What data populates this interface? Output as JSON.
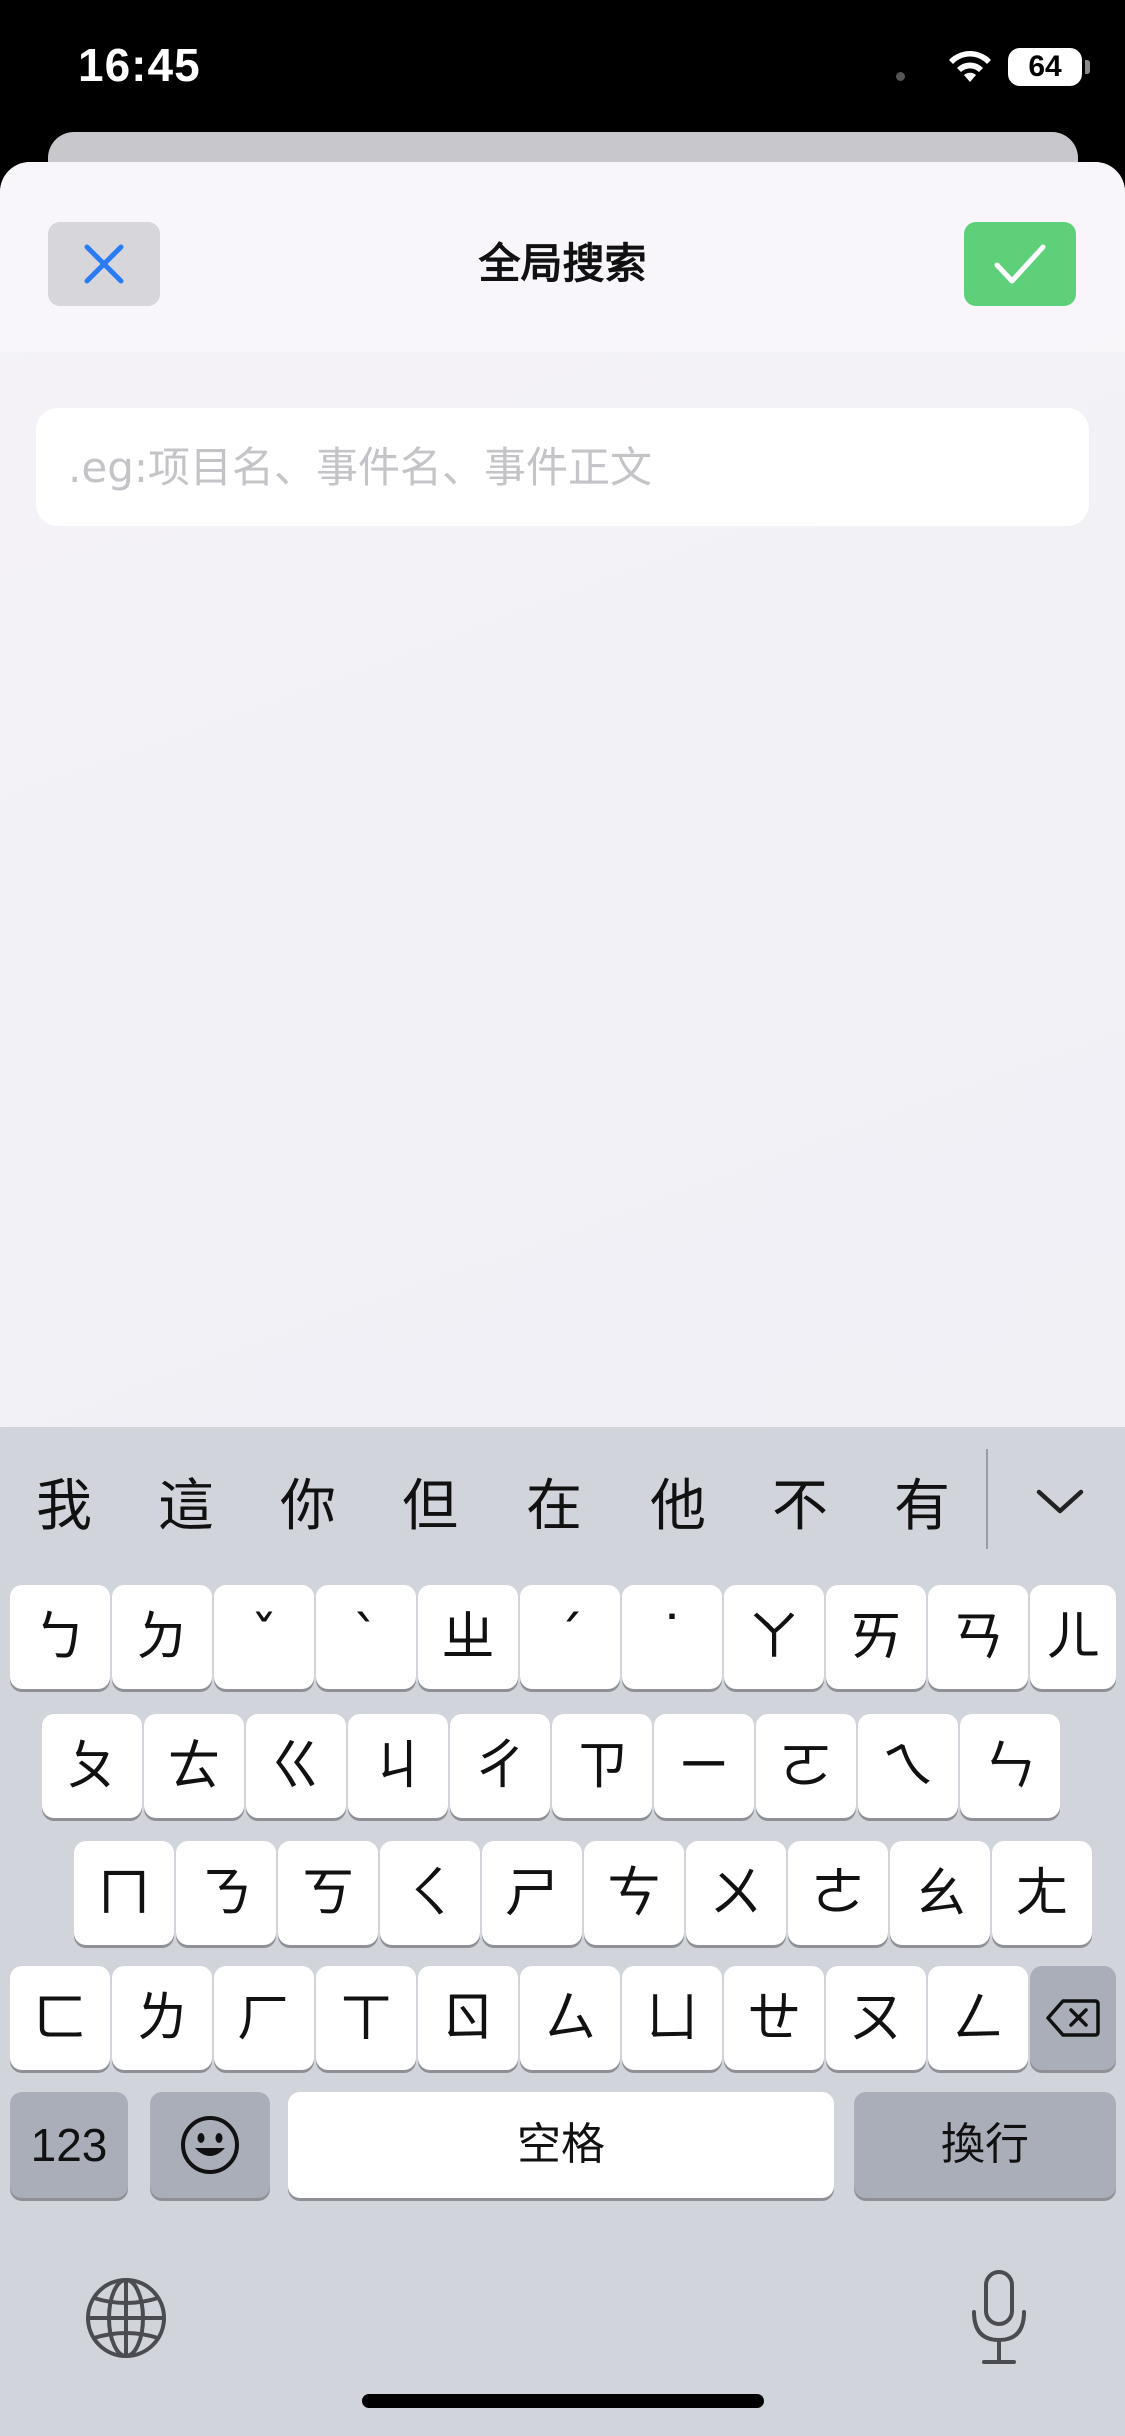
{
  "status_bar": {
    "time": "16:45",
    "battery": "64"
  },
  "sheet": {
    "title": "全局搜索",
    "close_icon": "close-x-icon",
    "confirm_icon": "checkmark-icon",
    "search": {
      "value": "",
      "placeholder": ".eg:项目名、事件名、事件正文"
    }
  },
  "keyboard": {
    "candidates": [
      "我",
      "這",
      "你",
      "但",
      "在",
      "他",
      "不",
      "有"
    ],
    "rows": [
      [
        "ㄅ",
        "ㄉ",
        "ˇ",
        "ˋ",
        "ㄓ",
        "ˊ",
        "˙",
        "ㄚ",
        "ㄞ",
        "ㄢ",
        "ㄦ"
      ],
      [
        "ㄆ",
        "ㄊ",
        "ㄍ",
        "ㄐ",
        "ㄔ",
        "ㄗ",
        "ㄧ",
        "ㄛ",
        "ㄟ",
        "ㄣ"
      ],
      [
        "ㄇ",
        "ㄋ",
        "ㄎ",
        "ㄑ",
        "ㄕ",
        "ㄘ",
        "ㄨ",
        "ㄜ",
        "ㄠ",
        "ㄤ"
      ],
      [
        "ㄈ",
        "ㄌ",
        "ㄏ",
        "ㄒ",
        "ㄖ",
        "ㄙ",
        "ㄩ",
        "ㄝ",
        "ㄡ",
        "ㄥ"
      ]
    ],
    "numbers_label": "123",
    "space_label": "空格",
    "return_label": "換行"
  }
}
